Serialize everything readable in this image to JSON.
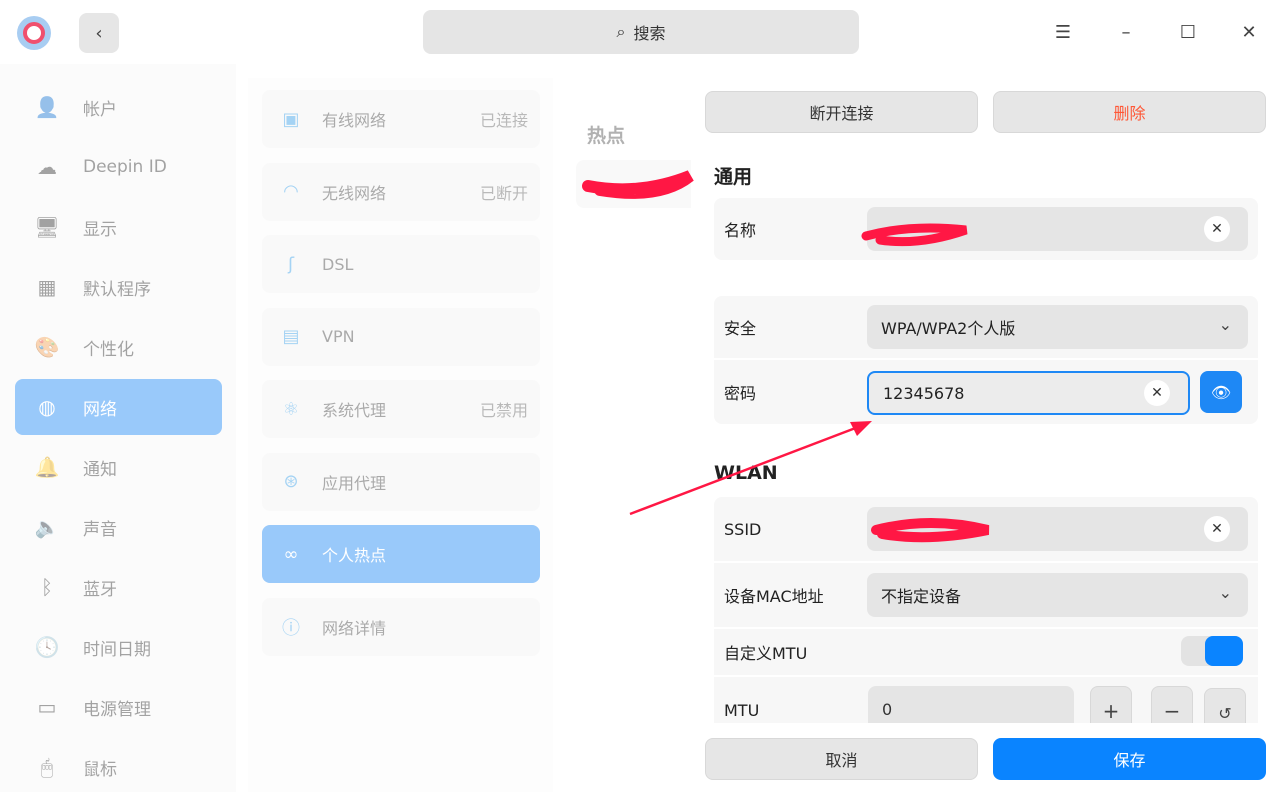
{
  "titlebar": {
    "search_placeholder": "搜索"
  },
  "sidebar": {
    "items": [
      {
        "label": "帐户",
        "icon": "user-icon"
      },
      {
        "label": "Deepin ID",
        "icon": "cloud-icon"
      },
      {
        "label": "显示",
        "icon": "monitor-icon"
      },
      {
        "label": "默认程序",
        "icon": "apps-icon"
      },
      {
        "label": "个性化",
        "icon": "palette-icon"
      },
      {
        "label": "网络",
        "icon": "network-icon"
      },
      {
        "label": "通知",
        "icon": "bell-icon"
      },
      {
        "label": "声音",
        "icon": "speaker-icon"
      },
      {
        "label": "蓝牙",
        "icon": "bluetooth-icon"
      },
      {
        "label": "时间日期",
        "icon": "clock-icon"
      },
      {
        "label": "电源管理",
        "icon": "battery-icon"
      },
      {
        "label": "鼠标",
        "icon": "mouse-icon"
      }
    ]
  },
  "network": {
    "items": [
      {
        "label": "有线网络",
        "status": "已连接"
      },
      {
        "label": "无线网络",
        "status": "已断开"
      },
      {
        "label": "DSL",
        "status": ""
      },
      {
        "label": "VPN",
        "status": ""
      },
      {
        "label": "系统代理",
        "status": "已禁用"
      },
      {
        "label": "应用代理",
        "status": ""
      },
      {
        "label": "个人热点",
        "status": ""
      },
      {
        "label": "网络详情",
        "status": ""
      }
    ]
  },
  "hotspot": {
    "title": "热点"
  },
  "detail": {
    "disconnect": "断开连接",
    "delete": "删除",
    "general_title": "通用",
    "name_label": "名称",
    "security_label": "安全",
    "security_value": "WPA/WPA2个人版",
    "password_label": "密码",
    "password_value": "12345678",
    "wlan_title": "WLAN",
    "ssid_label": "SSID",
    "mac_label": "设备MAC地址",
    "mac_value": "不指定设备",
    "custom_mtu_label": "自定义MTU",
    "custom_mtu_on": true,
    "mtu_label": "MTU",
    "mtu_value": "0",
    "cancel": "取消",
    "save": "保存"
  },
  "colors": {
    "accent": "#1e88f5",
    "danger": "#ff5736",
    "annotation": "#ff1744"
  }
}
